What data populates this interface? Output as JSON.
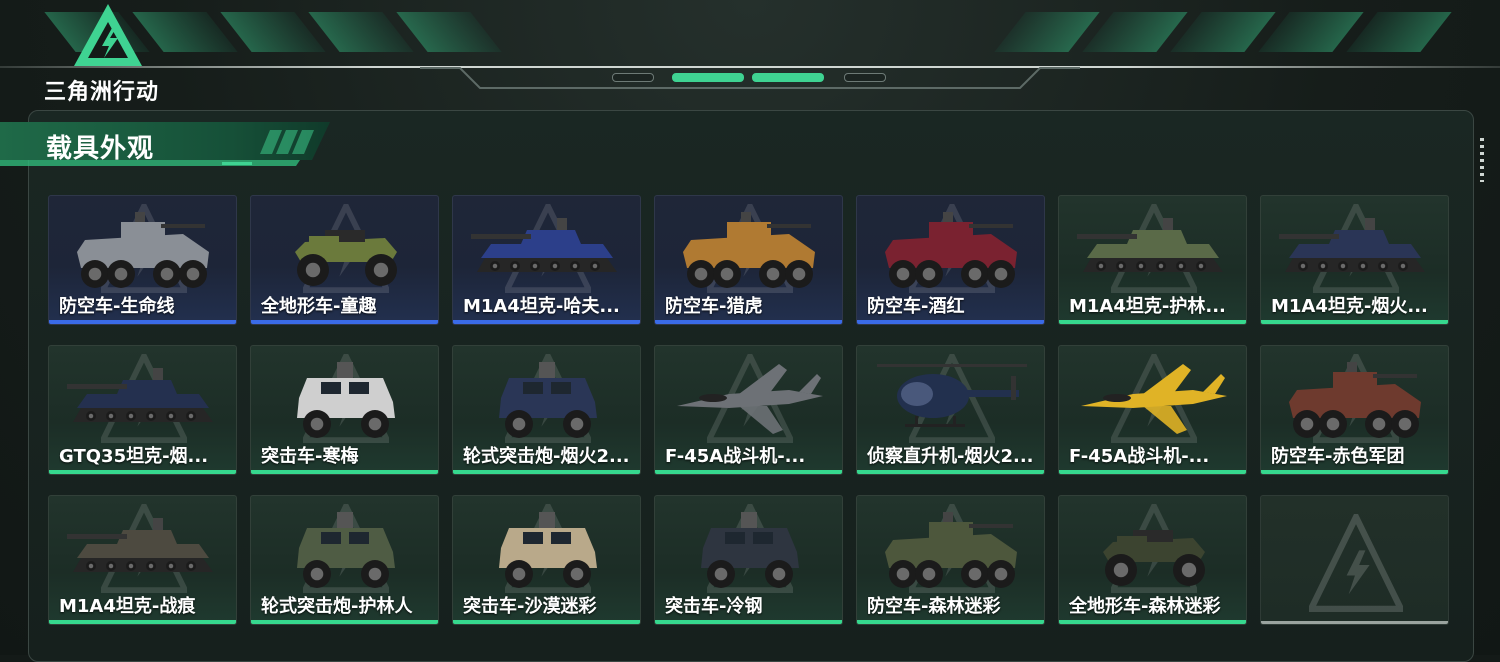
{
  "header": {
    "logo_text": "三角洲行动",
    "logo_icon": "delta-triangle-logo-icon"
  },
  "section": {
    "title": "载具外观"
  },
  "colors": {
    "accent_green": "#36d88e",
    "rarity_blue": "#3a6be8",
    "empty_bar": "#9aa39f"
  },
  "items": [
    {
      "name": "防空车-生命线",
      "rarity": "blue",
      "icon": "wheeled-aa-vehicle-icon",
      "color": "#8a8f96",
      "kind": "apc"
    },
    {
      "name": "全地形车-童趣",
      "rarity": "blue",
      "icon": "atv-icon",
      "color": "#6b7a3c",
      "kind": "atv"
    },
    {
      "name": "M1A4坦克-哈夫...",
      "rarity": "blue",
      "icon": "tank-icon",
      "color": "#2c3f8a",
      "kind": "tank"
    },
    {
      "name": "防空车-猎虎",
      "rarity": "blue",
      "icon": "wheeled-aa-vehicle-icon",
      "color": "#b07a32",
      "kind": "apc"
    },
    {
      "name": "防空车-酒红",
      "rarity": "blue",
      "icon": "wheeled-aa-vehicle-icon",
      "color": "#7a2230",
      "kind": "apc"
    },
    {
      "name": "M1A4坦克-护林...",
      "rarity": "green",
      "icon": "tank-icon",
      "color": "#5a6a48",
      "kind": "tank"
    },
    {
      "name": "M1A4坦克-烟火...",
      "rarity": "green",
      "icon": "tank-icon",
      "color": "#2a3556",
      "kind": "tank"
    },
    {
      "name": "GTQ35坦克-烟...",
      "rarity": "green",
      "icon": "tank-icon",
      "color": "#24304f",
      "kind": "tank"
    },
    {
      "name": "突击车-寒梅",
      "rarity": "green",
      "icon": "armored-car-icon",
      "color": "#cfcfcf",
      "kind": "mrap"
    },
    {
      "name": "轮式突击炮-烟火2...",
      "rarity": "green",
      "icon": "armored-car-icon",
      "color": "#2a3656",
      "kind": "mrap"
    },
    {
      "name": "F-45A战斗机-...",
      "rarity": "green",
      "icon": "fighter-jet-icon",
      "color": "#6d7176",
      "kind": "jet"
    },
    {
      "name": "侦察直升机-烟火2...",
      "rarity": "green",
      "icon": "helicopter-icon",
      "color": "#22304e",
      "kind": "heli"
    },
    {
      "name": "F-45A战斗机-...",
      "rarity": "green",
      "icon": "fighter-jet-icon",
      "color": "#e0b326",
      "kind": "jet"
    },
    {
      "name": "防空车-赤色军团",
      "rarity": "green",
      "icon": "wheeled-aa-vehicle-icon",
      "color": "#6e3a2e",
      "kind": "apc"
    },
    {
      "name": "M1A4坦克-战痕",
      "rarity": "green",
      "icon": "tank-icon",
      "color": "#4d4a40",
      "kind": "tank"
    },
    {
      "name": "轮式突击炮-护林人",
      "rarity": "green",
      "icon": "armored-car-icon",
      "color": "#4f5c44",
      "kind": "mrap"
    },
    {
      "name": "突击车-沙漠迷彩",
      "rarity": "green",
      "icon": "armored-car-icon",
      "color": "#b9a98a",
      "kind": "mrap"
    },
    {
      "name": "突击车-冷钢",
      "rarity": "green",
      "icon": "armored-car-icon",
      "color": "#2e3540",
      "kind": "mrap"
    },
    {
      "name": "防空车-森林迷彩",
      "rarity": "green",
      "icon": "wheeled-aa-vehicle-icon",
      "color": "#4d573c",
      "kind": "apc"
    },
    {
      "name": "全地形车-森林迷彩",
      "rarity": "green",
      "icon": "atv-icon",
      "color": "#3c4430",
      "kind": "atv"
    },
    {
      "name": "",
      "rarity": "empty",
      "icon": "empty-slot-icon",
      "color": "",
      "kind": "empty"
    }
  ]
}
